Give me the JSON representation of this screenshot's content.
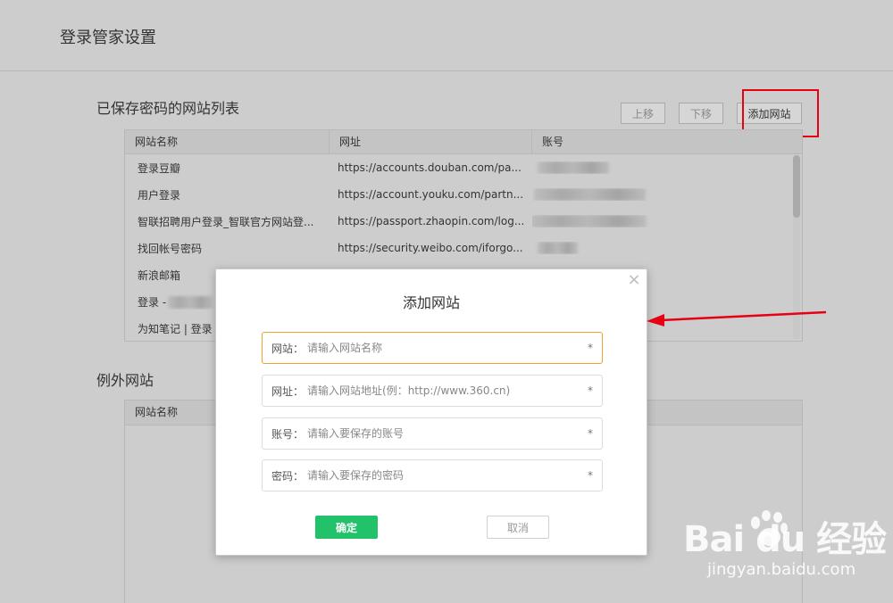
{
  "page": {
    "title": "登录管家设置"
  },
  "saved": {
    "title": "已保存密码的网站列表",
    "buttons": {
      "up": "上移",
      "down": "下移",
      "add": "添加网站"
    },
    "columns": [
      "网站名称",
      "网址",
      "账号"
    ],
    "rows": [
      {
        "name": "登录豆瓣",
        "url": "https://accounts.douban.com/pa..."
      },
      {
        "name": "用户登录",
        "url": "https://account.youku.com/partn..."
      },
      {
        "name": "智联招聘用户登录_智联官方网站登...",
        "url": "https://passport.zhaopin.com/log..."
      },
      {
        "name": "找回帐号密码",
        "url": "https://security.weibo.com/iforgo..."
      },
      {
        "name": "新浪邮箱",
        "url": ""
      },
      {
        "name": "登录 -",
        "url": ""
      },
      {
        "name": "为知笔记 | 登录",
        "url": ""
      }
    ]
  },
  "exceptions": {
    "title": "例外网站",
    "columns": [
      "网站名称"
    ]
  },
  "dialog": {
    "title": "添加网站",
    "close_icon": "close-icon",
    "fields": [
      {
        "label": "网站：",
        "placeholder": "请输入网站名称",
        "required": "*"
      },
      {
        "label": "网址：",
        "placeholder": "请输入网站地址(例：http://www.360.cn)",
        "required": "*"
      },
      {
        "label": "账号：",
        "placeholder": "请输入要保存的账号",
        "required": "*"
      },
      {
        "label": "密码：",
        "placeholder": "请输入要保存的密码",
        "required": "*"
      }
    ],
    "ok": "确定",
    "cancel": "取消"
  },
  "watermark": {
    "logo": "Bai du 经验",
    "url": "jingyan.baidu.com"
  },
  "colors": {
    "ok_green": "#22c26a",
    "annotation_red": "#e60012",
    "focus_orange": "#f0a030"
  }
}
